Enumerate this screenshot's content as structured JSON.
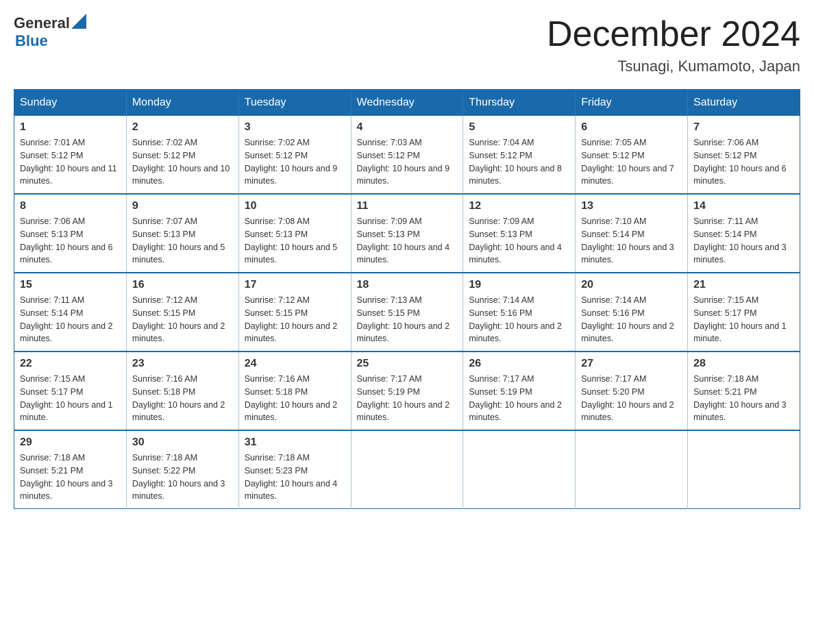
{
  "logo": {
    "general": "General",
    "triangle": "▶",
    "blue": "Blue"
  },
  "title": {
    "month_year": "December 2024",
    "location": "Tsunagi, Kumamoto, Japan"
  },
  "header_days": [
    "Sunday",
    "Monday",
    "Tuesday",
    "Wednesday",
    "Thursday",
    "Friday",
    "Saturday"
  ],
  "weeks": [
    [
      {
        "day": "1",
        "sunrise": "7:01 AM",
        "sunset": "5:12 PM",
        "daylight": "10 hours and 11 minutes."
      },
      {
        "day": "2",
        "sunrise": "7:02 AM",
        "sunset": "5:12 PM",
        "daylight": "10 hours and 10 minutes."
      },
      {
        "day": "3",
        "sunrise": "7:02 AM",
        "sunset": "5:12 PM",
        "daylight": "10 hours and 9 minutes."
      },
      {
        "day": "4",
        "sunrise": "7:03 AM",
        "sunset": "5:12 PM",
        "daylight": "10 hours and 9 minutes."
      },
      {
        "day": "5",
        "sunrise": "7:04 AM",
        "sunset": "5:12 PM",
        "daylight": "10 hours and 8 minutes."
      },
      {
        "day": "6",
        "sunrise": "7:05 AM",
        "sunset": "5:12 PM",
        "daylight": "10 hours and 7 minutes."
      },
      {
        "day": "7",
        "sunrise": "7:06 AM",
        "sunset": "5:12 PM",
        "daylight": "10 hours and 6 minutes."
      }
    ],
    [
      {
        "day": "8",
        "sunrise": "7:06 AM",
        "sunset": "5:13 PM",
        "daylight": "10 hours and 6 minutes."
      },
      {
        "day": "9",
        "sunrise": "7:07 AM",
        "sunset": "5:13 PM",
        "daylight": "10 hours and 5 minutes."
      },
      {
        "day": "10",
        "sunrise": "7:08 AM",
        "sunset": "5:13 PM",
        "daylight": "10 hours and 5 minutes."
      },
      {
        "day": "11",
        "sunrise": "7:09 AM",
        "sunset": "5:13 PM",
        "daylight": "10 hours and 4 minutes."
      },
      {
        "day": "12",
        "sunrise": "7:09 AM",
        "sunset": "5:13 PM",
        "daylight": "10 hours and 4 minutes."
      },
      {
        "day": "13",
        "sunrise": "7:10 AM",
        "sunset": "5:14 PM",
        "daylight": "10 hours and 3 minutes."
      },
      {
        "day": "14",
        "sunrise": "7:11 AM",
        "sunset": "5:14 PM",
        "daylight": "10 hours and 3 minutes."
      }
    ],
    [
      {
        "day": "15",
        "sunrise": "7:11 AM",
        "sunset": "5:14 PM",
        "daylight": "10 hours and 2 minutes."
      },
      {
        "day": "16",
        "sunrise": "7:12 AM",
        "sunset": "5:15 PM",
        "daylight": "10 hours and 2 minutes."
      },
      {
        "day": "17",
        "sunrise": "7:12 AM",
        "sunset": "5:15 PM",
        "daylight": "10 hours and 2 minutes."
      },
      {
        "day": "18",
        "sunrise": "7:13 AM",
        "sunset": "5:15 PM",
        "daylight": "10 hours and 2 minutes."
      },
      {
        "day": "19",
        "sunrise": "7:14 AM",
        "sunset": "5:16 PM",
        "daylight": "10 hours and 2 minutes."
      },
      {
        "day": "20",
        "sunrise": "7:14 AM",
        "sunset": "5:16 PM",
        "daylight": "10 hours and 2 minutes."
      },
      {
        "day": "21",
        "sunrise": "7:15 AM",
        "sunset": "5:17 PM",
        "daylight": "10 hours and 1 minute."
      }
    ],
    [
      {
        "day": "22",
        "sunrise": "7:15 AM",
        "sunset": "5:17 PM",
        "daylight": "10 hours and 1 minute."
      },
      {
        "day": "23",
        "sunrise": "7:16 AM",
        "sunset": "5:18 PM",
        "daylight": "10 hours and 2 minutes."
      },
      {
        "day": "24",
        "sunrise": "7:16 AM",
        "sunset": "5:18 PM",
        "daylight": "10 hours and 2 minutes."
      },
      {
        "day": "25",
        "sunrise": "7:17 AM",
        "sunset": "5:19 PM",
        "daylight": "10 hours and 2 minutes."
      },
      {
        "day": "26",
        "sunrise": "7:17 AM",
        "sunset": "5:19 PM",
        "daylight": "10 hours and 2 minutes."
      },
      {
        "day": "27",
        "sunrise": "7:17 AM",
        "sunset": "5:20 PM",
        "daylight": "10 hours and 2 minutes."
      },
      {
        "day": "28",
        "sunrise": "7:18 AM",
        "sunset": "5:21 PM",
        "daylight": "10 hours and 3 minutes."
      }
    ],
    [
      {
        "day": "29",
        "sunrise": "7:18 AM",
        "sunset": "5:21 PM",
        "daylight": "10 hours and 3 minutes."
      },
      {
        "day": "30",
        "sunrise": "7:18 AM",
        "sunset": "5:22 PM",
        "daylight": "10 hours and 3 minutes."
      },
      {
        "day": "31",
        "sunrise": "7:18 AM",
        "sunset": "5:23 PM",
        "daylight": "10 hours and 4 minutes."
      },
      null,
      null,
      null,
      null
    ]
  ]
}
